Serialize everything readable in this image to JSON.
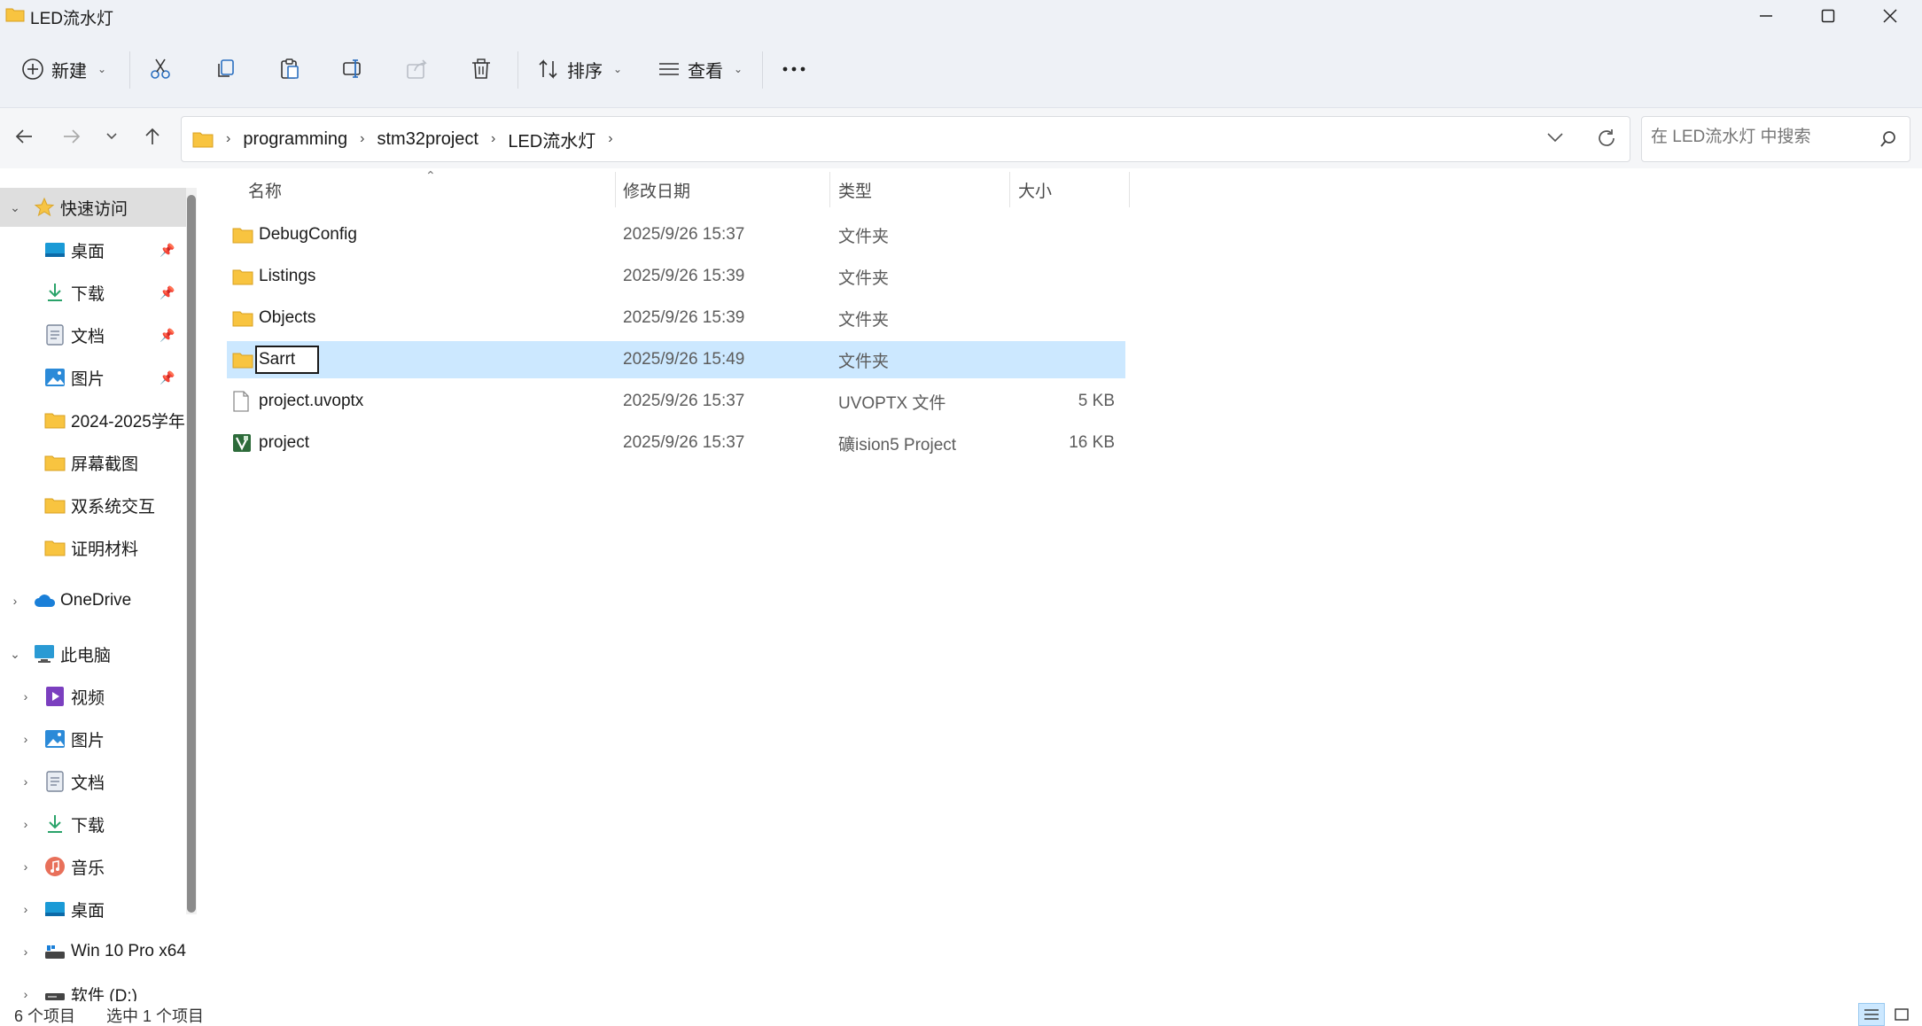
{
  "window": {
    "title": "LED流水灯",
    "minimize_label": "minimize",
    "maximize_label": "maximize",
    "close_label": "close"
  },
  "toolbar": {
    "new_label": "新建",
    "sort_label": "排序",
    "view_label": "查看"
  },
  "address": {
    "crumbs": [
      "programming",
      "stm32project",
      "LED流水灯"
    ]
  },
  "search": {
    "placeholder": "在 LED流水灯 中搜索"
  },
  "sidebar": {
    "quick_access": "快速访问",
    "quick_items": [
      {
        "label": "桌面",
        "icon": "desktop-icon",
        "pinned": true
      },
      {
        "label": "下载",
        "icon": "download-icon",
        "pinned": true
      },
      {
        "label": "文档",
        "icon": "document-icon",
        "pinned": true
      },
      {
        "label": "图片",
        "icon": "picture-icon",
        "pinned": true
      },
      {
        "label": "2024-2025学年",
        "icon": "folder-icon",
        "pinned": false
      },
      {
        "label": "屏幕截图",
        "icon": "folder-icon",
        "pinned": false
      },
      {
        "label": "双系统交互",
        "icon": "folder-icon",
        "pinned": false
      },
      {
        "label": "证明材料",
        "icon": "folder-icon",
        "pinned": false
      }
    ],
    "onedrive": "OneDrive",
    "this_pc": "此电脑",
    "pc_items": [
      {
        "label": "视频",
        "icon": "video-icon"
      },
      {
        "label": "图片",
        "icon": "picture-icon"
      },
      {
        "label": "文档",
        "icon": "document-icon"
      },
      {
        "label": "下载",
        "icon": "download-icon"
      },
      {
        "label": "音乐",
        "icon": "music-icon"
      },
      {
        "label": "桌面",
        "icon": "desktop-icon"
      },
      {
        "label": "Win 10 Pro x64",
        "icon": "drive-icon"
      },
      {
        "label": "软件 (D:)",
        "icon": "drive-icon"
      }
    ]
  },
  "columns": {
    "name": "名称",
    "modified": "修改日期",
    "type": "类型",
    "size": "大小"
  },
  "files": [
    {
      "name": "DebugConfig",
      "modified": "2025/9/26 15:37",
      "type": "文件夹",
      "size": "",
      "icon": "folder-icon"
    },
    {
      "name": "Listings",
      "modified": "2025/9/26 15:39",
      "type": "文件夹",
      "size": "",
      "icon": "folder-icon"
    },
    {
      "name": "Objects",
      "modified": "2025/9/26 15:39",
      "type": "文件夹",
      "size": "",
      "icon": "folder-icon"
    },
    {
      "name": "Sarrt",
      "modified": "2025/9/26 15:49",
      "type": "文件夹",
      "size": "",
      "icon": "folder-icon",
      "selected": true,
      "renaming": true
    },
    {
      "name": "project.uvoptx",
      "modified": "2025/9/26 15:37",
      "type": "UVOPTX 文件",
      "size": "5 KB",
      "icon": "file-icon"
    },
    {
      "name": "project",
      "modified": "2025/9/26 15:37",
      "type": "礦ision5 Project",
      "size": "16 KB",
      "icon": "keil-project-icon"
    }
  ],
  "status": {
    "count": "6 个项目",
    "selection": "选中 1 个项目"
  },
  "colors": {
    "accent": "#0067c0",
    "selection": "#cce8ff",
    "folder": "#f8c440"
  }
}
